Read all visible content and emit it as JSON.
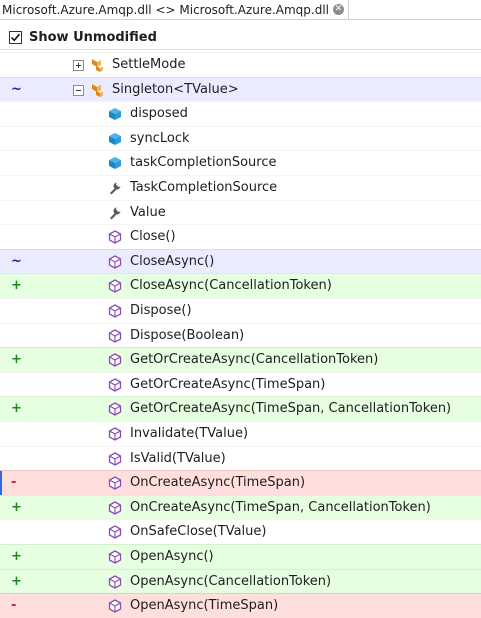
{
  "tab": {
    "title": "Microsoft.Azure.Amqp.dll <> Microsoft.Azure.Amqp.dll",
    "close_icon": "close-icon"
  },
  "toolbar": {
    "show_unmodified_label": "Show Unmodified",
    "show_unmodified_checked": true
  },
  "colors": {
    "added": "#e6ffe1",
    "removed": "#ffdede",
    "modified": "#ebebff"
  },
  "tree": [
    {
      "label": "SettleMode",
      "icon": "class-icon",
      "status": "none",
      "marker": "",
      "expander": "plus",
      "level": 1
    },
    {
      "label": "Singleton<TValue>",
      "icon": "class-icon",
      "status": "mod",
      "marker": "~",
      "expander": "minus",
      "level": 1
    },
    {
      "label": "disposed",
      "icon": "field-icon",
      "status": "none",
      "marker": "",
      "level": 2
    },
    {
      "label": "syncLock",
      "icon": "field-icon",
      "status": "none",
      "marker": "",
      "level": 2
    },
    {
      "label": "taskCompletionSource",
      "icon": "field-icon",
      "status": "none",
      "marker": "",
      "level": 2
    },
    {
      "label": "TaskCompletionSource",
      "icon": "property-icon",
      "status": "none",
      "marker": "",
      "level": 2
    },
    {
      "label": "Value",
      "icon": "property-icon",
      "status": "none",
      "marker": "",
      "level": 2
    },
    {
      "label": "Close()",
      "icon": "method-icon",
      "status": "none",
      "marker": "",
      "level": 2
    },
    {
      "label": "CloseAsync()",
      "icon": "method-icon",
      "status": "mod",
      "marker": "~",
      "level": 2
    },
    {
      "label": "CloseAsync(CancellationToken)",
      "icon": "method-icon",
      "status": "add",
      "marker": "+",
      "level": 2
    },
    {
      "label": "Dispose()",
      "icon": "method-icon",
      "status": "none",
      "marker": "",
      "level": 2
    },
    {
      "label": "Dispose(Boolean)",
      "icon": "method-icon",
      "status": "none",
      "marker": "",
      "level": 2
    },
    {
      "label": "GetOrCreateAsync(CancellationToken)",
      "icon": "method-icon",
      "status": "add",
      "marker": "+",
      "level": 2
    },
    {
      "label": "GetOrCreateAsync(TimeSpan)",
      "icon": "method-icon",
      "status": "none",
      "marker": "",
      "level": 2
    },
    {
      "label": "GetOrCreateAsync(TimeSpan, CancellationToken)",
      "icon": "method-icon",
      "status": "add",
      "marker": "+",
      "level": 2
    },
    {
      "label": "Invalidate(TValue)",
      "icon": "method-icon",
      "status": "none",
      "marker": "",
      "level": 2
    },
    {
      "label": "IsValid(TValue)",
      "icon": "method-icon",
      "status": "none",
      "marker": "",
      "level": 2
    },
    {
      "label": "OnCreateAsync(TimeSpan)",
      "icon": "method-icon",
      "status": "del",
      "marker": "-",
      "level": 2,
      "selected": true
    },
    {
      "label": "OnCreateAsync(TimeSpan, CancellationToken)",
      "icon": "method-icon",
      "status": "add",
      "marker": "+",
      "level": 2
    },
    {
      "label": "OnSafeClose(TValue)",
      "icon": "method-icon",
      "status": "none",
      "marker": "",
      "level": 2
    },
    {
      "label": "OpenAsync()",
      "icon": "method-icon",
      "status": "add",
      "marker": "+",
      "level": 2
    },
    {
      "label": "OpenAsync(CancellationToken)",
      "icon": "method-icon",
      "status": "add",
      "marker": "+",
      "level": 2
    },
    {
      "label": "OpenAsync(TimeSpan)",
      "icon": "method-icon",
      "status": "del",
      "marker": "-",
      "level": 2
    }
  ]
}
